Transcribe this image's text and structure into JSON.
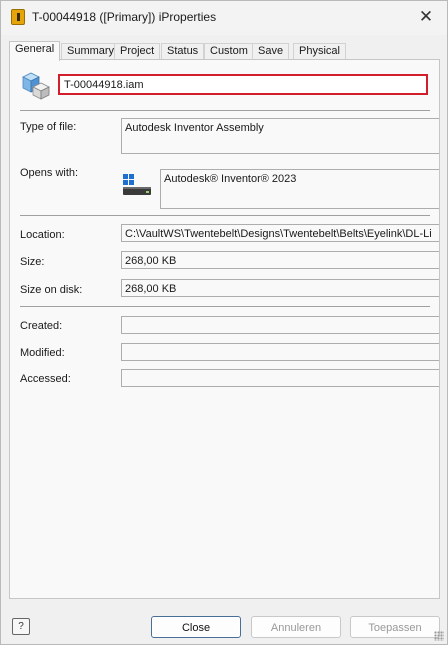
{
  "window": {
    "title": "T-00044918 ([Primary]) iProperties",
    "close_glyph": "✕"
  },
  "tabs": [
    {
      "label": "General"
    },
    {
      "label": "Summary"
    },
    {
      "label": "Project"
    },
    {
      "label": "Status"
    },
    {
      "label": "Custom"
    },
    {
      "label": "Save"
    },
    {
      "label": "Physical"
    }
  ],
  "general": {
    "file_name": "T-00044918.iam",
    "type_of_file_label": "Type of file:",
    "type_of_file": "Autodesk Inventor Assembly",
    "opens_with_label": "Opens with:",
    "opens_with": "Autodesk® Inventor® 2023",
    "location_label": "Location:",
    "location": "C:\\VaultWS\\Twentebelt\\Designs\\Twentebelt\\Belts\\Eyelink\\DL-Li",
    "size_label": "Size:",
    "size": "268,00 KB",
    "size_on_disk_label": "Size on disk:",
    "size_on_disk": "268,00 KB",
    "created_label": "Created:",
    "created": "",
    "modified_label": "Modified:",
    "modified": "",
    "accessed_label": "Accessed:",
    "accessed": ""
  },
  "footer": {
    "help_glyph": "?",
    "close_label": "Close",
    "cancel_label": "Annuleren",
    "apply_label": "Toepassen"
  },
  "icons": {
    "app": "inventor-app-icon",
    "file": "assembly-file-icon",
    "opens_with": "inventor-program-icon"
  }
}
